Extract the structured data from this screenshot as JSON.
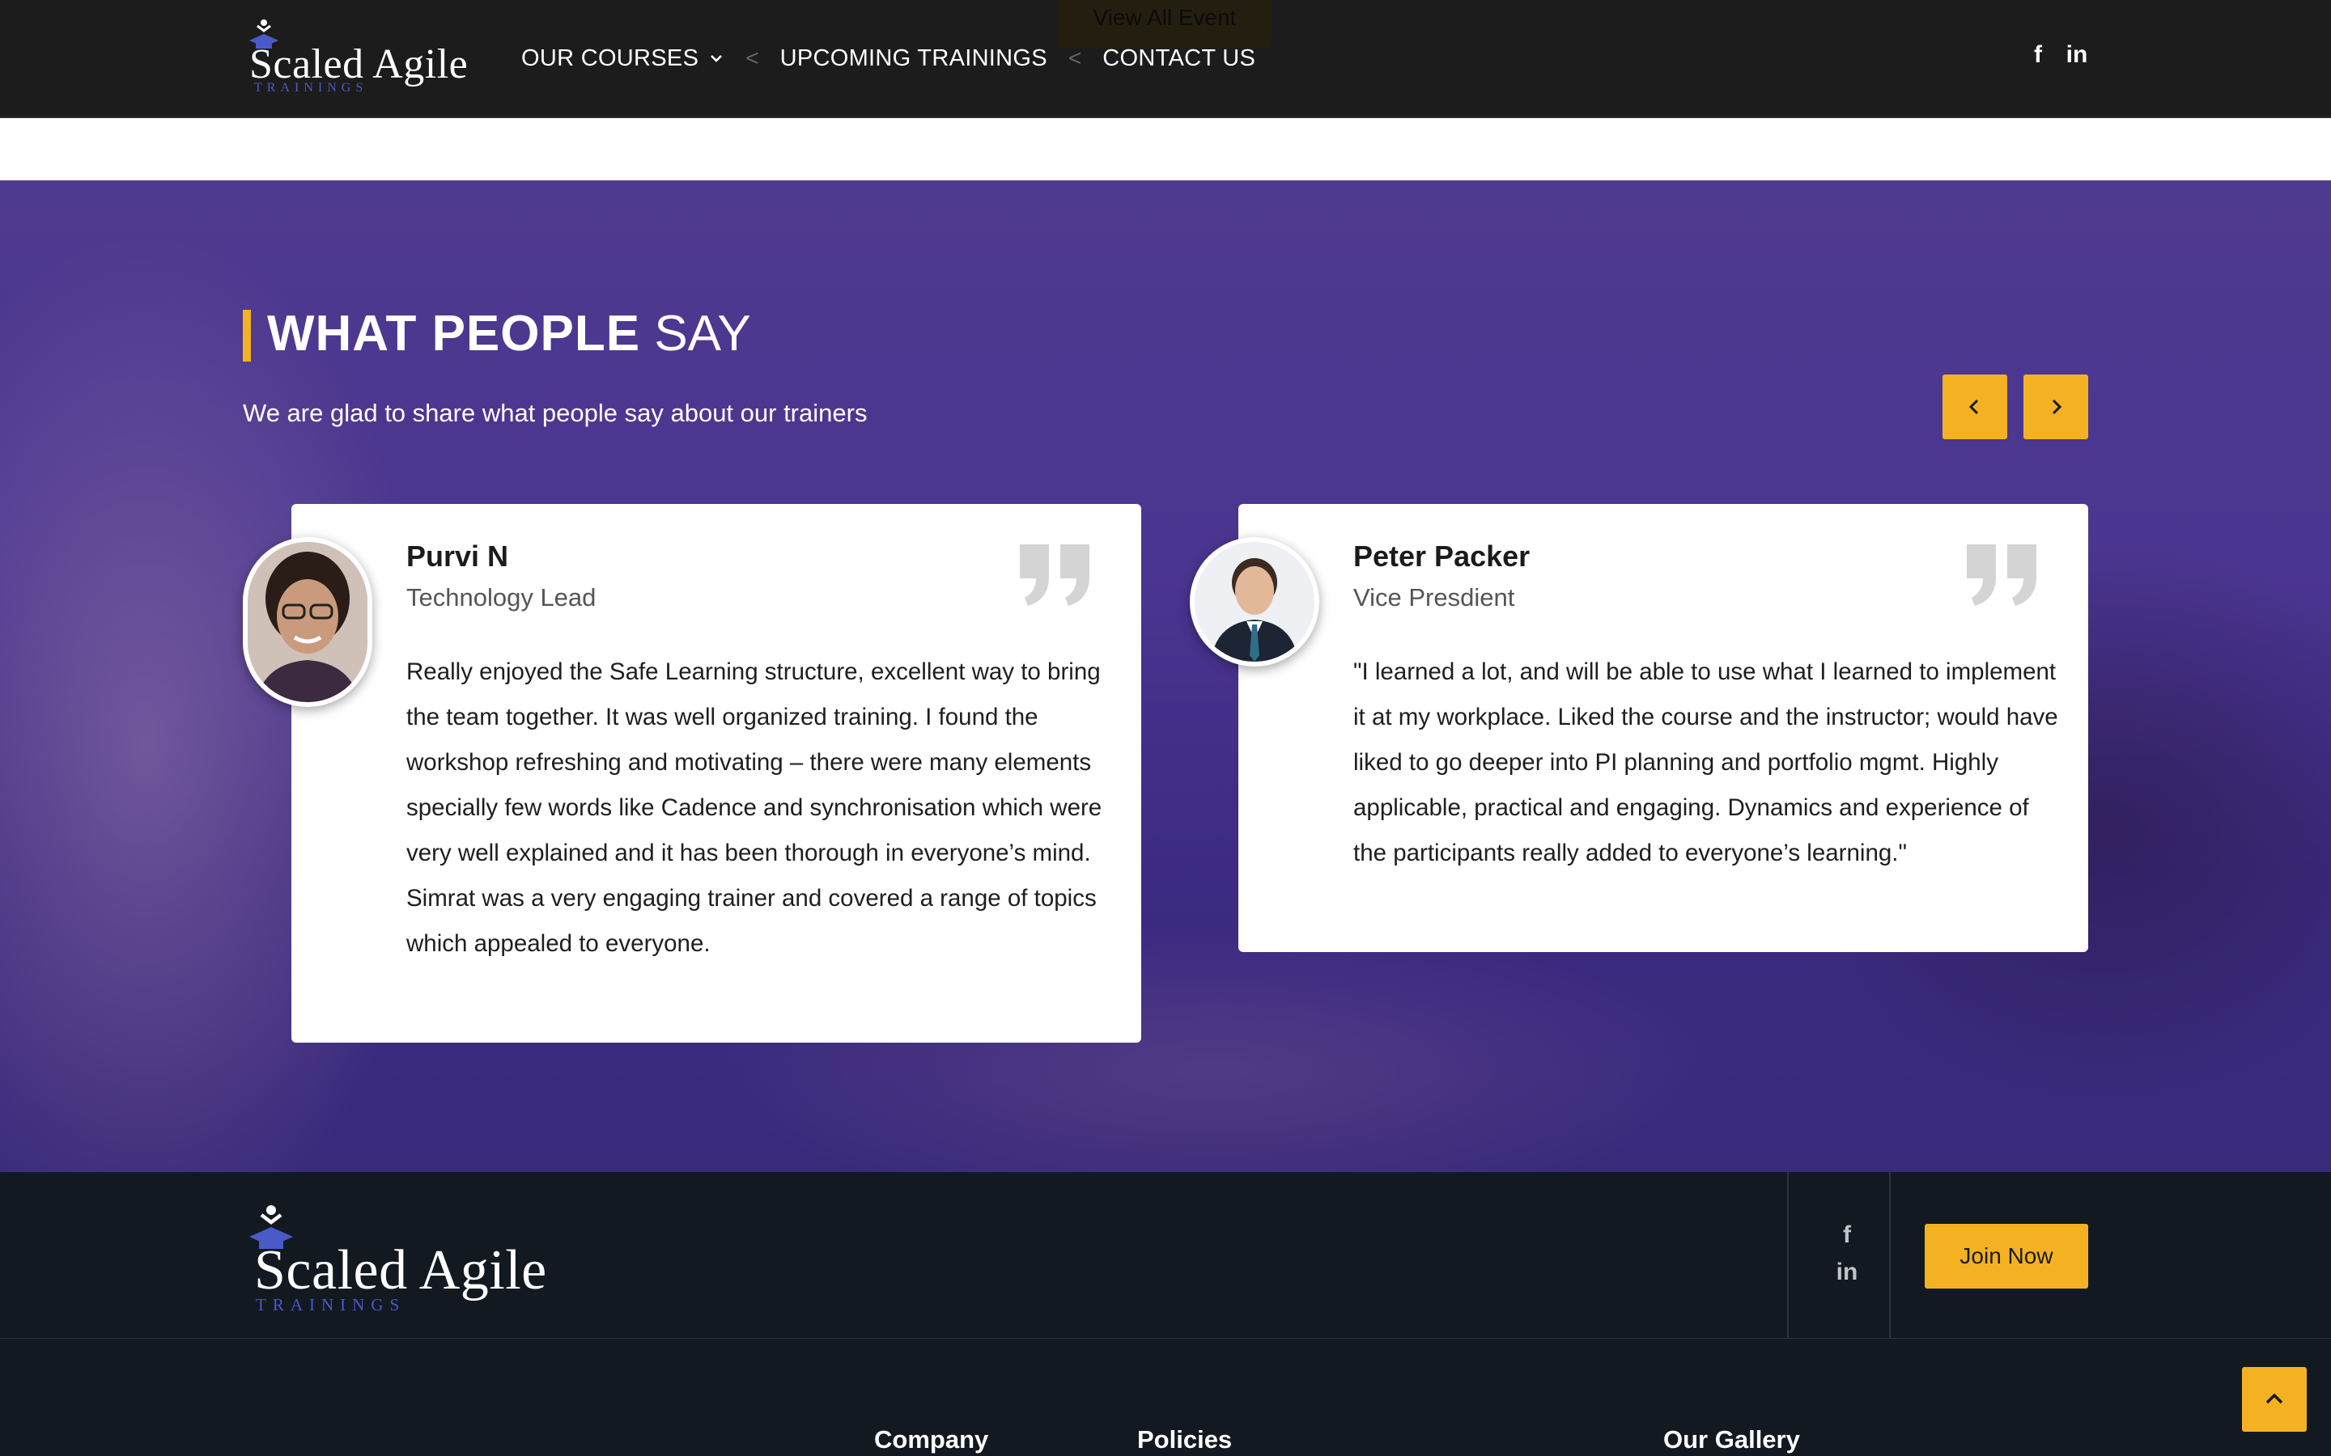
{
  "header": {
    "ghost_button": "View All Event",
    "logo": {
      "title": "Scaled Agile",
      "subtitle": "TRAININGS"
    },
    "nav": [
      {
        "label": "OUR COURSES",
        "has_dropdown": true
      },
      {
        "label": "UPCOMING TRAININGS"
      },
      {
        "label": "CONTACT US"
      }
    ],
    "nav_separator": "<",
    "social": [
      {
        "icon": "facebook-icon",
        "glyph": "f"
      },
      {
        "icon": "linkedin-icon",
        "glyph": "in"
      }
    ]
  },
  "testimonials": {
    "title_bold": "WHAT PEOPLE",
    "title_light": "SAY",
    "subtitle": "We are glad to share what people say about our trainers",
    "prev_icon": "chevron-left-icon",
    "next_icon": "chevron-right-icon",
    "items": [
      {
        "name": "Purvi N",
        "role": "Technology Lead",
        "text": "Really enjoyed the Safe Learning structure, excellent way to bring the team together. It was well organized training. I found the workshop refreshing and motivating – there were many elements specially few words like Cadence and synchronisation which were very well explained and it has been thorough in everyone’s mind. Simrat was a very engaging trainer and covered a range of topics which appealed to everyone."
      },
      {
        "name": "Peter Packer",
        "role": "Vice Presdient",
        "text": "\"I learned a lot, and will be able to use what I learned to implement it at my workplace. Liked the course and the instructor; would have liked to go deeper into PI planning and portfolio mgmt. Highly applicable, practical and engaging. Dynamics and experience of the participants really added to everyone’s learning.\""
      }
    ]
  },
  "footer": {
    "logo": {
      "title": "Scaled Agile",
      "subtitle": "TRAININGS"
    },
    "social": [
      {
        "icon": "facebook-icon",
        "glyph": "f"
      },
      {
        "icon": "linkedin-icon",
        "glyph": "in"
      }
    ],
    "join_button": "Join Now",
    "columns": [
      "Company",
      "Policies",
      "Our Gallery"
    ]
  },
  "colors": {
    "accent": "#f4b223",
    "header_bg": "#1c1c1c",
    "footer_bg": "#131921",
    "section_overlay": "#4a3590",
    "logo_accent": "#4a5ac8"
  }
}
